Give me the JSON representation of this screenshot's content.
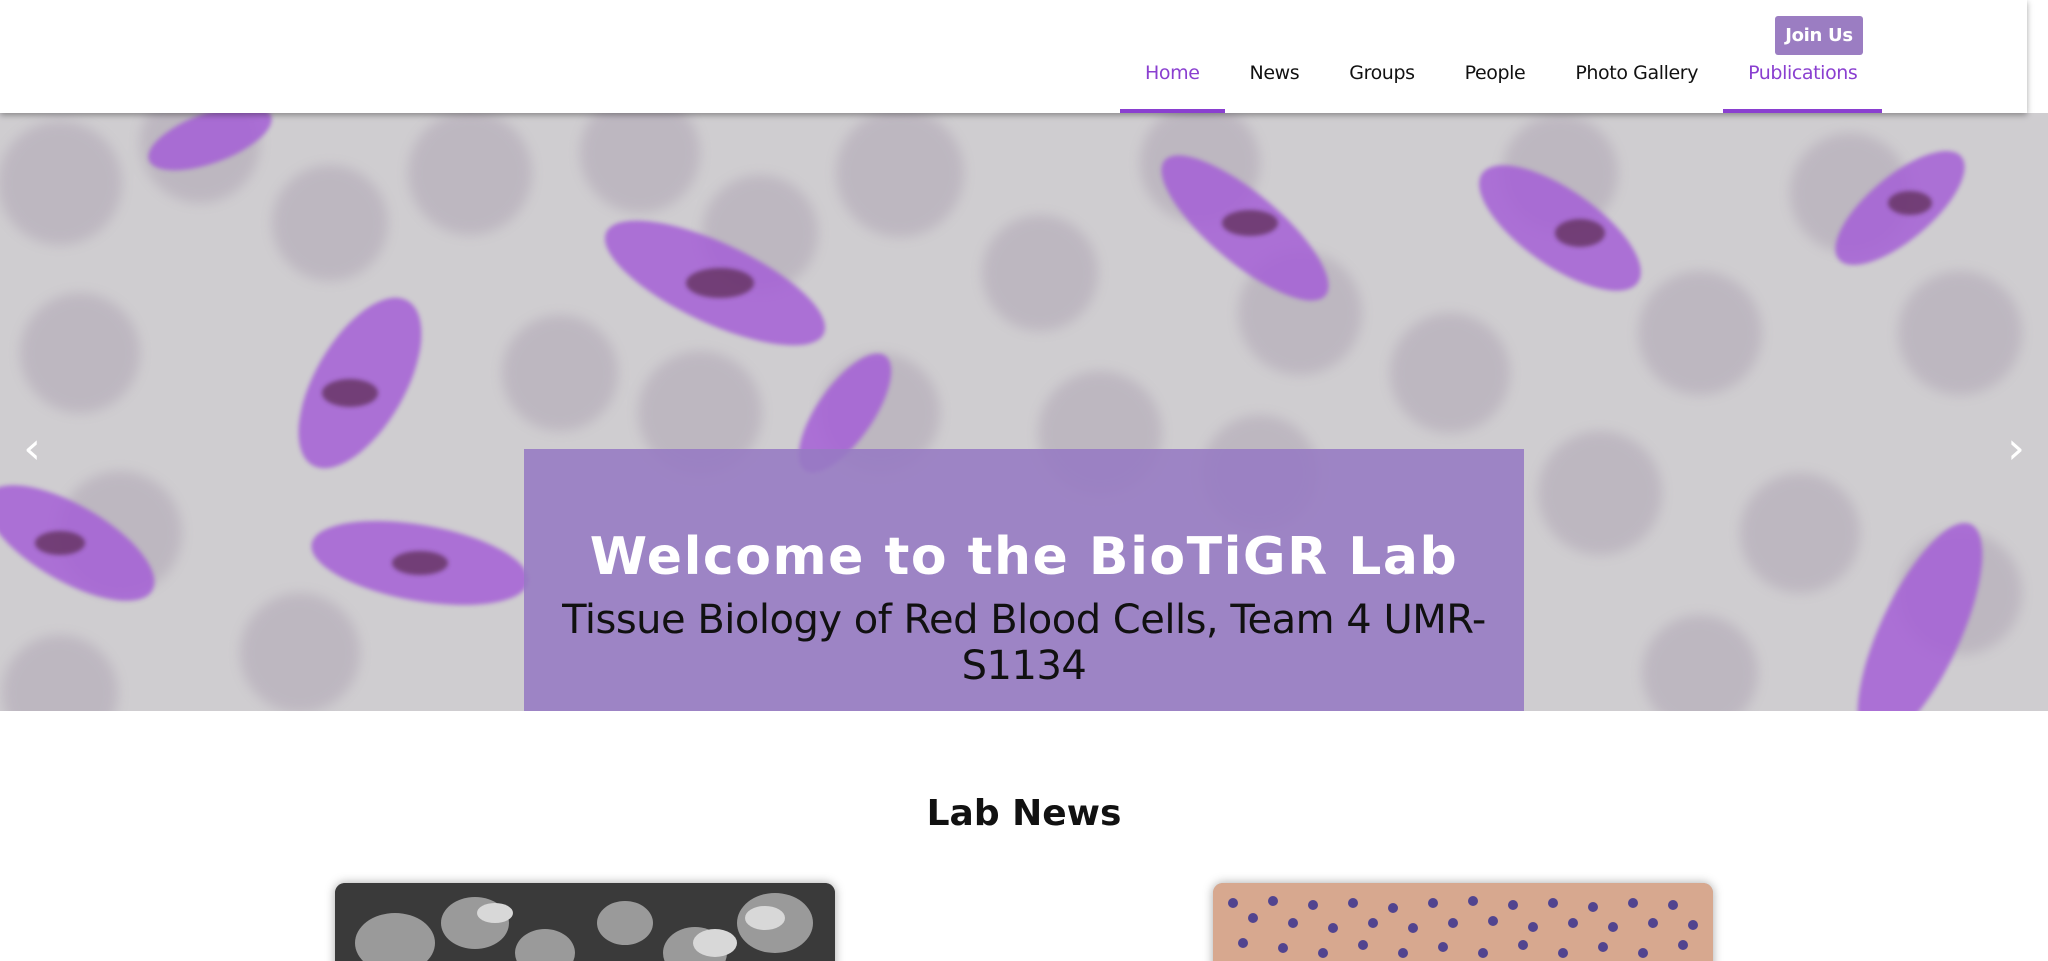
{
  "header": {
    "join_label": "Join Us",
    "nav": [
      {
        "label": "Home"
      },
      {
        "label": "News"
      },
      {
        "label": "Groups"
      },
      {
        "label": "People"
      },
      {
        "label": "Photo Gallery"
      },
      {
        "label": "Publications"
      }
    ]
  },
  "hero": {
    "title": "Welcome to the BioTiGR Lab",
    "subtitle": "Tissue Biology of Red Blood Cells, Team 4 UMR-S1134",
    "prev_icon": "chevron-left-icon",
    "next_icon": "chevron-right-icon"
  },
  "news": {
    "heading": "Lab News"
  },
  "colors": {
    "accent": "#8a3fd0",
    "button": "#9b7dc2",
    "caption_bg": "#967ac3"
  }
}
